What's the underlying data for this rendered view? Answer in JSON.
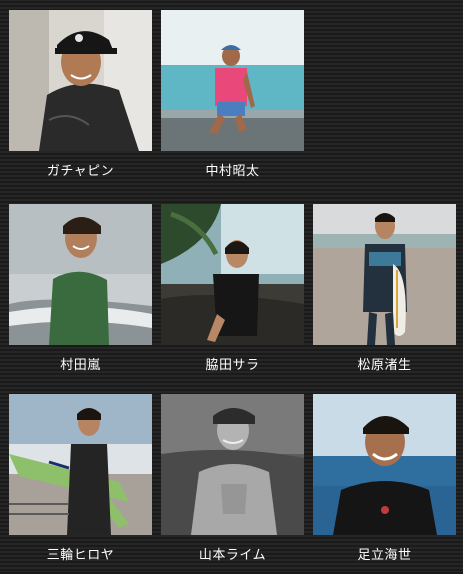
{
  "members": [
    {
      "name": "ガチャピン"
    },
    {
      "name": "中村昭太"
    },
    {
      "name": "村田嵐"
    },
    {
      "name": "脇田サラ"
    },
    {
      "name": "松原渚生"
    },
    {
      "name": "三輪ヒロヤ"
    },
    {
      "name": "山本ライム"
    },
    {
      "name": "足立海世"
    }
  ],
  "colors": {
    "background": "#1c1c1c",
    "name_text": "#ffffff"
  }
}
